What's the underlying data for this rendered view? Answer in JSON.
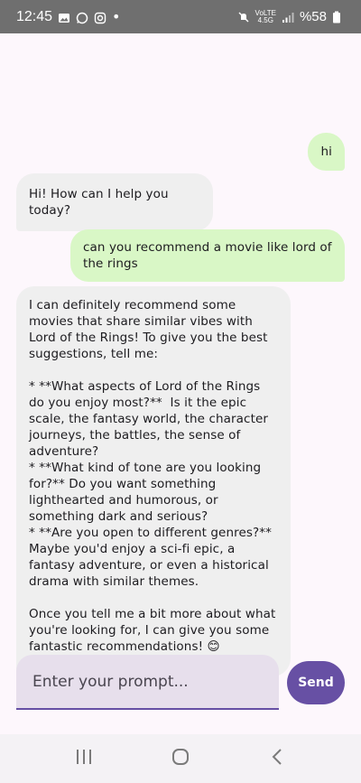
{
  "status_bar": {
    "time": "12:45",
    "net_top": "VoLTE",
    "net_bottom": "4.5G",
    "battery": "%58",
    "dot": "•"
  },
  "chat": {
    "messages": [
      {
        "role": "user",
        "text": "hi"
      },
      {
        "role": "bot",
        "text": "Hi! How can I help you today?"
      },
      {
        "role": "user",
        "text": "can you recommend a movie like lord of the rings"
      },
      {
        "role": "bot",
        "text": "I can definitely recommend some movies that share similar vibes with Lord of the Rings! To give you the best suggestions, tell me:\n\n* **What aspects of Lord of the Rings do you enjoy most?**  Is it the epic scale, the fantasy world, the character journeys, the battles, the sense of adventure?\n* **What kind of tone are you looking for?** Do you want something lighthearted and humorous, or something dark and serious?\n* **Are you open to different genres?** Maybe you'd enjoy a sci-fi epic, a fantasy adventure, or even a historical drama with similar themes.\n\nOnce you tell me a bit more about what you're looking for, I can give you some fantastic recommendations! 😊"
      }
    ]
  },
  "composer": {
    "placeholder": "Enter your prompt...",
    "value": "",
    "send_label": "Send"
  },
  "colors": {
    "user_bubble": "#d9f7c6",
    "bot_bubble": "#efefef",
    "accent": "#6750a4",
    "input_bg": "#e7dfec"
  },
  "icons": [
    "gallery-icon",
    "whatsapp-icon",
    "instagram-icon",
    "mute-icon",
    "signal-icon",
    "battery-icon",
    "recents-icon",
    "home-icon",
    "back-icon"
  ]
}
